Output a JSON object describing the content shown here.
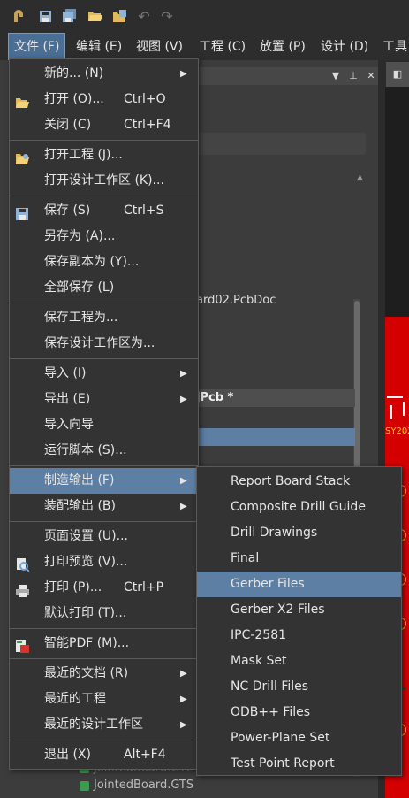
{
  "toolbar": {
    "icons": [
      "app-logo-icon",
      "save-icon",
      "save-all-icon",
      "open-folder-icon",
      "open-workspace-icon",
      "undo-icon",
      "redo-icon"
    ]
  },
  "menubar": {
    "items": [
      "文件 (F)",
      "编辑 (E)",
      "视图 (V)",
      "工程 (C)",
      "放置 (P)",
      "设计 (D)",
      "工具"
    ]
  },
  "background": {
    "doc_file": "ard02.PcbDoc",
    "project_name": "jPcb *",
    "bottom_file_1": "JointedBoard.GTL",
    "bottom_file_2": "JointedBoard.GTS",
    "pcb_silk": "SY202"
  },
  "file_menu": {
    "items": [
      {
        "label": "新的... (N)",
        "shortcut": "",
        "arrow": true,
        "icon": ""
      },
      {
        "label": "打开 (O)...",
        "shortcut": "Ctrl+O",
        "arrow": false,
        "icon": "open-folder-icon"
      },
      {
        "label": "关闭 (C)",
        "shortcut": "Ctrl+F4",
        "arrow": false,
        "icon": ""
      },
      {
        "label": "打开工程 (J)...",
        "shortcut": "",
        "arrow": false,
        "icon": "open-project-icon"
      },
      {
        "label": "打开设计工作区 (K)...",
        "shortcut": "",
        "arrow": false,
        "icon": ""
      },
      {
        "label": "保存 (S)",
        "shortcut": "Ctrl+S",
        "arrow": false,
        "icon": "save-icon"
      },
      {
        "label": "另存为 (A)...",
        "shortcut": "",
        "arrow": false,
        "icon": ""
      },
      {
        "label": "保存副本为 (Y)...",
        "shortcut": "",
        "arrow": false,
        "icon": ""
      },
      {
        "label": "全部保存 (L)",
        "shortcut": "",
        "arrow": false,
        "icon": ""
      },
      {
        "label": "保存工程为...",
        "shortcut": "",
        "arrow": false,
        "icon": ""
      },
      {
        "label": "保存设计工作区为...",
        "shortcut": "",
        "arrow": false,
        "icon": ""
      },
      {
        "label": "导入 (I)",
        "shortcut": "",
        "arrow": true,
        "icon": ""
      },
      {
        "label": "导出 (E)",
        "shortcut": "",
        "arrow": true,
        "icon": ""
      },
      {
        "label": "导入向导",
        "shortcut": "",
        "arrow": false,
        "icon": ""
      },
      {
        "label": "运行脚本 (S)...",
        "shortcut": "",
        "arrow": false,
        "icon": ""
      },
      {
        "label": "制造输出 (F)",
        "shortcut": "",
        "arrow": true,
        "icon": "",
        "highlighted": true
      },
      {
        "label": "装配输出 (B)",
        "shortcut": "",
        "arrow": true,
        "icon": ""
      },
      {
        "label": "页面设置 (U)...",
        "shortcut": "",
        "arrow": false,
        "icon": ""
      },
      {
        "label": "打印预览 (V)...",
        "shortcut": "",
        "arrow": false,
        "icon": "print-preview-icon"
      },
      {
        "label": "打印 (P)...",
        "shortcut": "Ctrl+P",
        "arrow": false,
        "icon": "printer-icon"
      },
      {
        "label": "默认打印 (T)...",
        "shortcut": "",
        "arrow": false,
        "icon": ""
      },
      {
        "label": "智能PDF (M)...",
        "shortcut": "",
        "arrow": false,
        "icon": "smart-pdf-icon"
      },
      {
        "label": "最近的文档 (R)",
        "shortcut": "",
        "arrow": true,
        "icon": ""
      },
      {
        "label": "最近的工程",
        "shortcut": "",
        "arrow": true,
        "icon": ""
      },
      {
        "label": "最近的设计工作区",
        "shortcut": "",
        "arrow": true,
        "icon": ""
      },
      {
        "label": "退出 (X)",
        "shortcut": "Alt+F4",
        "arrow": false,
        "icon": ""
      }
    ]
  },
  "fab_submenu": {
    "items": [
      {
        "label": "Report Board Stack"
      },
      {
        "label": "Composite Drill Guide"
      },
      {
        "label": "Drill Drawings"
      },
      {
        "label": "Final"
      },
      {
        "label": "Gerber Files",
        "highlighted": true
      },
      {
        "label": "Gerber X2 Files"
      },
      {
        "label": "IPC-2581"
      },
      {
        "label": "Mask Set"
      },
      {
        "label": "NC Drill Files"
      },
      {
        "label": "ODB++ Files"
      },
      {
        "label": "Power-Plane Set"
      },
      {
        "label": "Test Point Report"
      }
    ]
  },
  "colors": {
    "menu_bg": "#333333",
    "highlight": "#5c7fa3",
    "active_top": "#4a6e94",
    "pcb_red": "#d40000"
  }
}
